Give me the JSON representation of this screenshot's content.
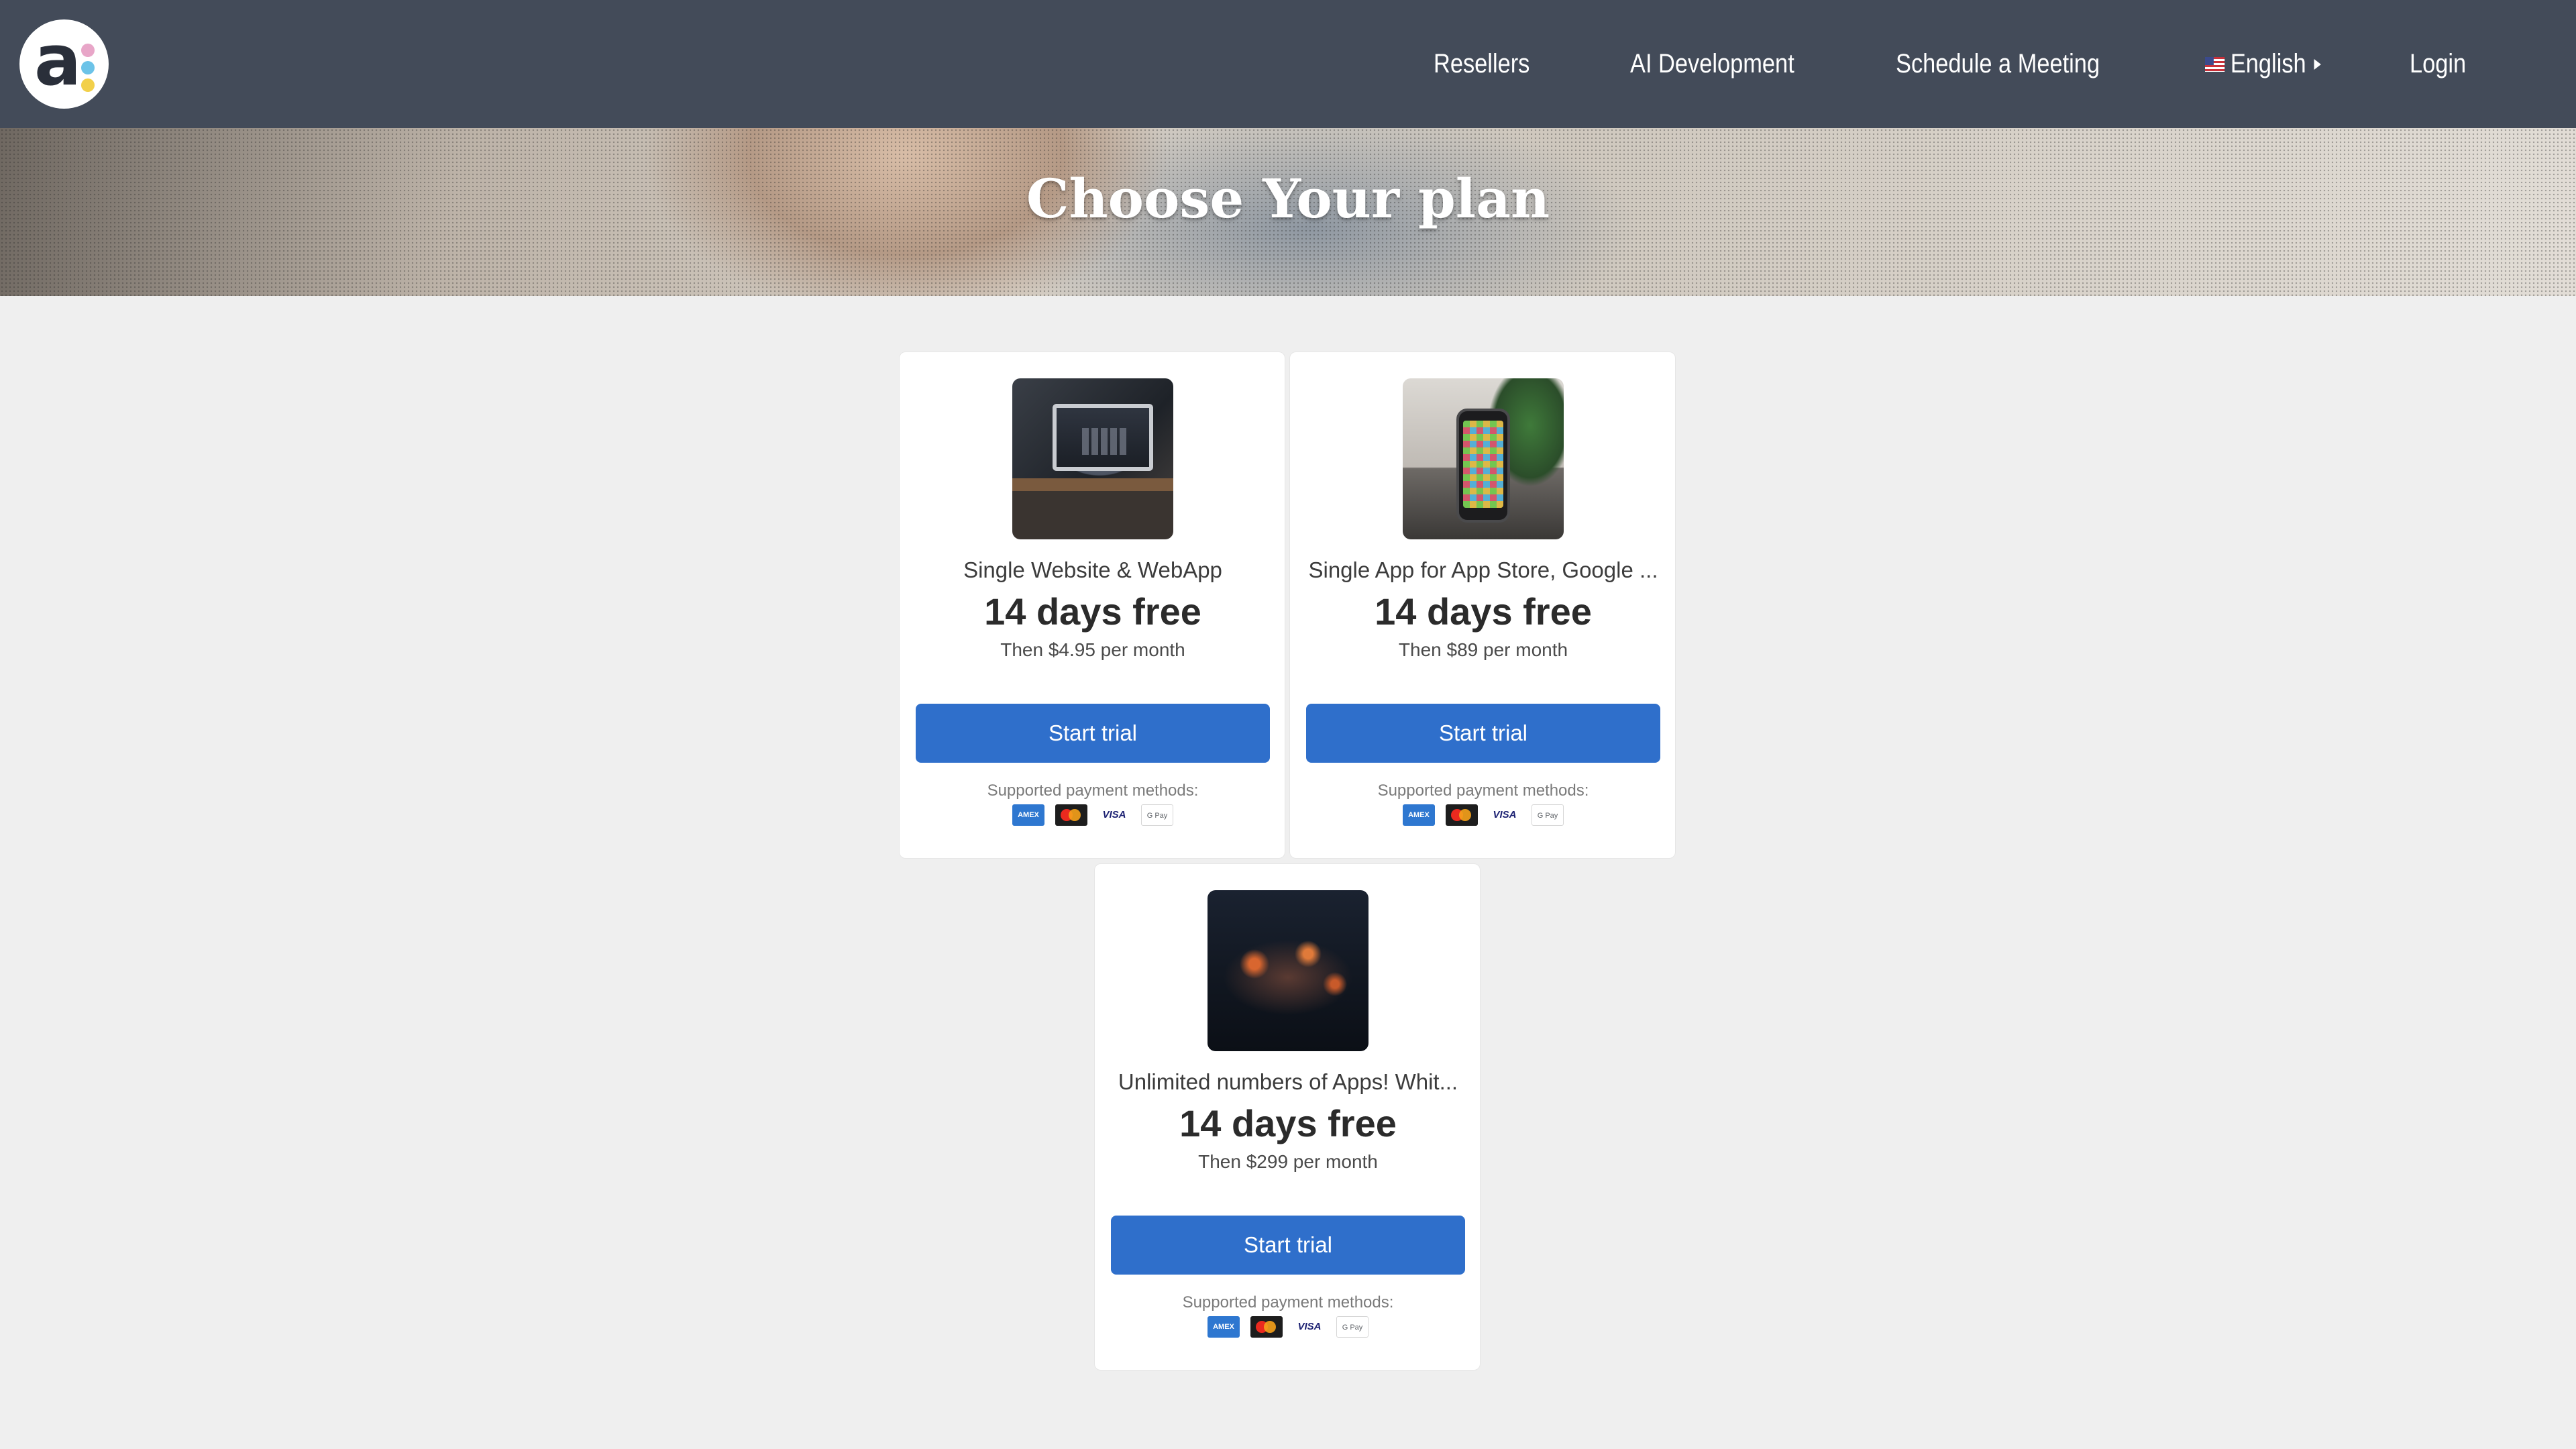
{
  "header": {
    "logo_letter": "a",
    "logo_dot_colors": [
      "#e8a6c8",
      "#6cc3e8",
      "#f2d04a"
    ],
    "nav": {
      "resellers": "Resellers",
      "ai_development": "AI Development",
      "schedule_meeting": "Schedule a Meeting",
      "language": "English",
      "login": "Login"
    },
    "background_color": "#434b59"
  },
  "hero": {
    "title": "Choose Your plan"
  },
  "plans": [
    {
      "name": "Single Website & WebApp",
      "trial": "14 days free",
      "price": "Then $4.95 per month",
      "button": "Start trial",
      "payment_label": "Supported payment methods:",
      "image": "desktop-computer-image"
    },
    {
      "name": "Single App for App Store, Google ...",
      "trial": "14 days free",
      "price": "Then $89 per month",
      "button": "Start trial",
      "payment_label": "Supported payment methods:",
      "image": "smartphone-image"
    },
    {
      "name": "Unlimited numbers of Apps! Whit...",
      "trial": "14 days free",
      "price": "Then $299 per month",
      "button": "Start trial",
      "payment_label": "Supported payment methods:",
      "image": "office-night-image"
    }
  ],
  "payment_methods": {
    "amex": "AMEX",
    "mastercard": "",
    "visa": "VISA",
    "gpay": "G Pay"
  },
  "colors": {
    "button": "#2f6fcb",
    "page_background": "#efefef"
  }
}
